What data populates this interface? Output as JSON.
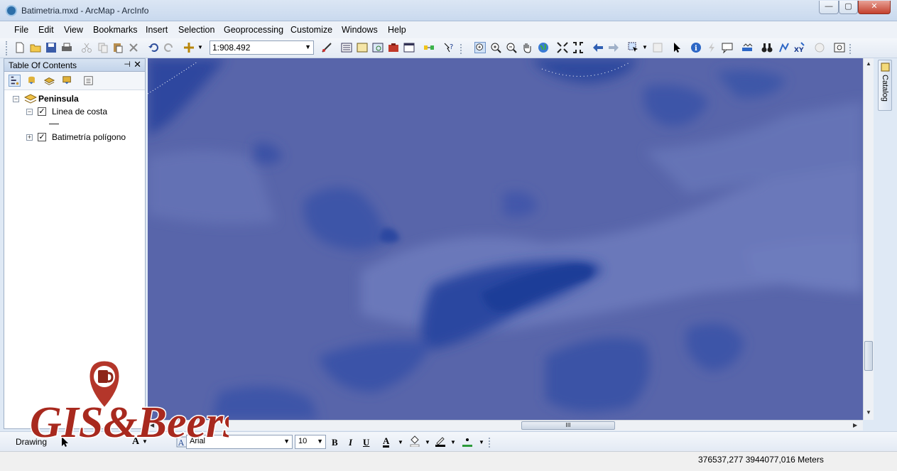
{
  "window": {
    "title": "Batimetria.mxd - ArcMap - ArcInfo",
    "minimize": "0",
    "maximize": "1",
    "close": "r"
  },
  "menu": [
    "File",
    "Edit",
    "View",
    "Bookmarks",
    "Insert",
    "Selection",
    "Geoprocessing",
    "Customize",
    "Windows",
    "Help"
  ],
  "toolbar": {
    "scale": "1:908.492"
  },
  "toc": {
    "title": "Table Of Contents",
    "data_frame": "Peninsula",
    "layers": [
      {
        "name": "Linea de costa",
        "checked": true,
        "expanded": true
      },
      {
        "name": "Batimetría polígono",
        "checked": true,
        "expanded": false
      }
    ]
  },
  "catalog_tab": "Catalog",
  "drawing": {
    "label": "Drawing",
    "font": "Arial",
    "size": "10",
    "bold": "B",
    "italic": "I",
    "underline": "U",
    "font_color_label": "A"
  },
  "status": {
    "coordinates": "376537,277  3944077,016 Meters"
  },
  "logo": {
    "text": "GIS&Beers"
  },
  "colors": {
    "map_base": "#5b67ad",
    "map_light": "#6a78ba",
    "map_dark": "#2a46a0",
    "map_deep": "#1e3c98"
  }
}
